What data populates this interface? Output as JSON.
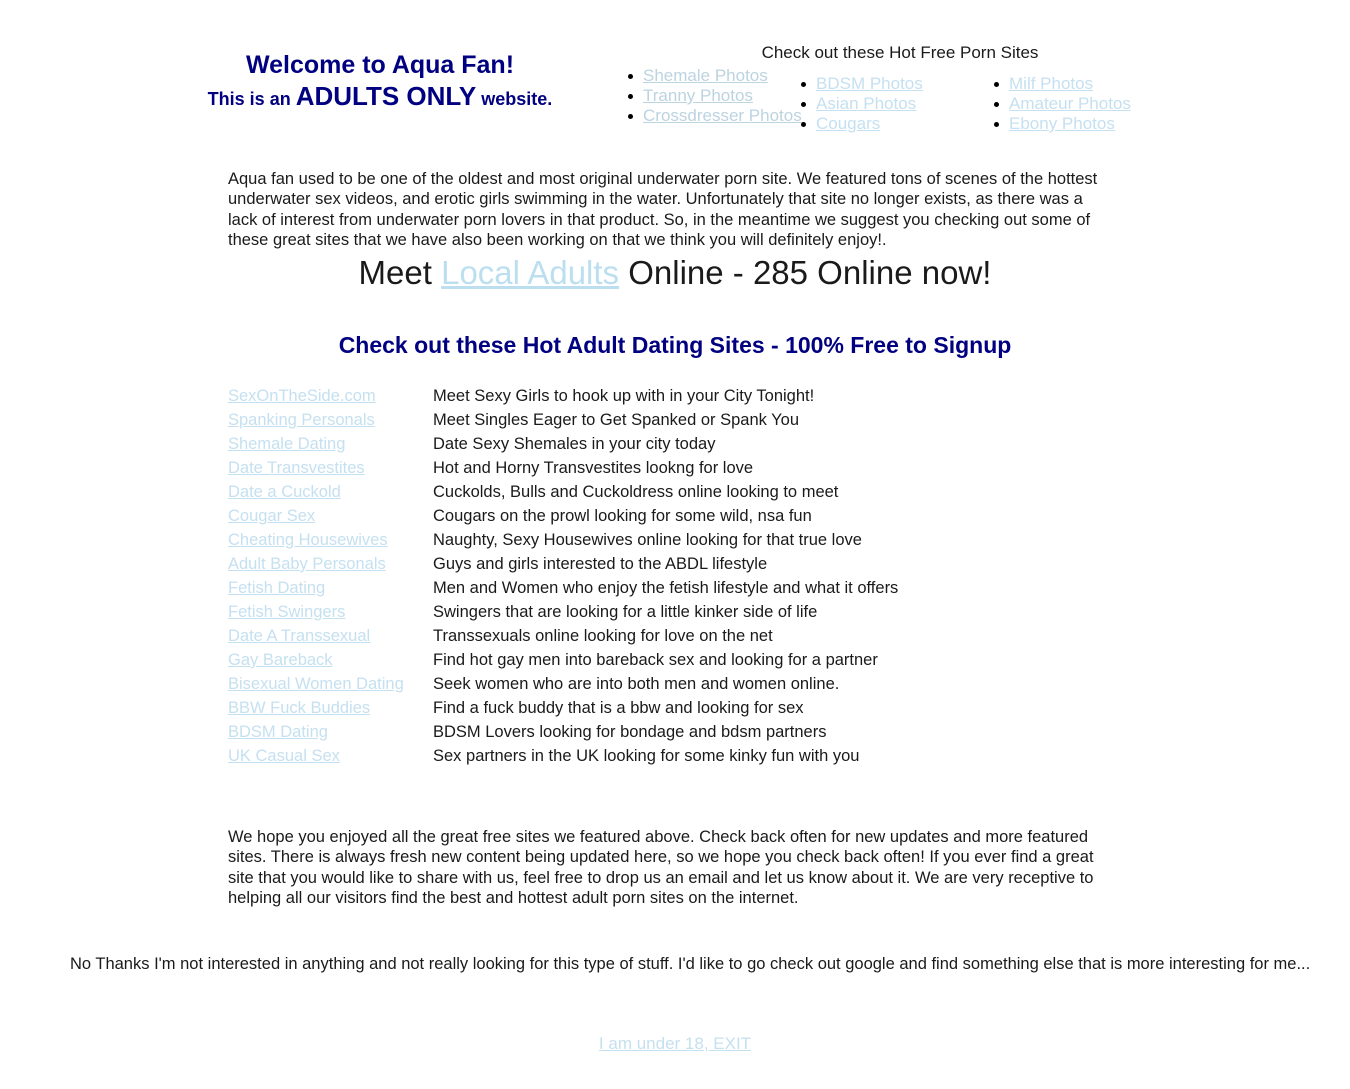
{
  "page": {
    "background_color": "#ffffff",
    "heading_color": "#000080",
    "link_color": "#c5e0f0",
    "text_color": "#1a1a1a"
  },
  "header": {
    "welcome_line1": "Welcome to Aqua Fan!",
    "welcome_prefix": "This is an ",
    "welcome_emphasis": "ADULTS ONLY",
    "welcome_suffix": " website.",
    "porn_sites_heading": "Check out these Hot Free Porn Sites",
    "bullet_columns": [
      {
        "items": [
          {
            "label": "Shemale Photos"
          },
          {
            "label": "Tranny Photos"
          },
          {
            "label": "Crossdresser Photos"
          }
        ]
      },
      {
        "items": [
          {
            "label": "BDSM Photos"
          },
          {
            "label": "Asian Photos"
          },
          {
            "label": "Cougars"
          }
        ]
      },
      {
        "items": [
          {
            "label": "Milf Photos"
          },
          {
            "label": "Amateur Photos"
          },
          {
            "label": "Ebony Photos"
          }
        ]
      }
    ]
  },
  "intro": {
    "paragraph": "Aqua fan used to be one of the oldest and most original underwater porn site. We featured tons of scenes of the hottest underwater sex videos, and erotic girls swimming in the water. Unfortunately that site no longer exists, as there was a lack of interest from underwater porn lovers in that product. So, in the meantime we suggest you checking out some of these great sites that we have also been working on that we think you will definitely enjoy!."
  },
  "meet": {
    "prefix": "Meet ",
    "link_label": "Local Adults",
    "suffix": " Online - 285 Online now!",
    "online_count": "285"
  },
  "dating": {
    "heading": "Check out these Hot Adult Dating Sites - 100% Free to Signup",
    "rows": [
      {
        "site": "SexOnTheSide.com",
        "desc": "Meet Sexy Girls to hook up with in your City Tonight!"
      },
      {
        "site": "Spanking Personals",
        "desc": "Meet Singles Eager to Get Spanked or Spank You"
      },
      {
        "site": "Shemale Dating",
        "desc": "Date Sexy Shemales in your city today"
      },
      {
        "site": "Date Transvestites",
        "desc": "Hot and Horny Transvestites lookng for love"
      },
      {
        "site": "Date a Cuckold",
        "desc": "Cuckolds, Bulls and Cuckoldress online looking to meet"
      },
      {
        "site": "Cougar Sex",
        "desc": "Cougars on the prowl looking for some wild, nsa fun"
      },
      {
        "site": "Cheating Housewives",
        "desc": "Naughty, Sexy Housewives online looking for that true love"
      },
      {
        "site": "Adult Baby Personals",
        "desc": "Guys and girls interested to the ABDL lifestyle"
      },
      {
        "site": "Fetish Dating",
        "desc": "Men and Women who enjoy the fetish lifestyle and what it offers"
      },
      {
        "site": "Fetish Swingers",
        "desc": "Swingers that are looking for a little kinker side of life"
      },
      {
        "site": "Date A Transsexual",
        "desc": "Transsexuals online looking for love on the net"
      },
      {
        "site": "Gay Bareback",
        "desc": "Find hot gay men into bareback sex and looking for a partner"
      },
      {
        "site": "Bisexual Women Dating",
        "desc": "Seek women who are into both men and women online."
      },
      {
        "site": "BBW Fuck Buddies",
        "desc": "Find a fuck buddy that is a bbw and looking for sex"
      },
      {
        "site": "BDSM Dating",
        "desc": "BDSM Lovers looking for bondage and bdsm partners"
      },
      {
        "site": "UK Casual Sex",
        "desc": "Sex partners in the UK looking for some kinky fun with you"
      }
    ]
  },
  "outro": {
    "paragraph": "We hope you enjoyed all the great free sites we featured above. Check back often for new updates and more featured sites. There is always fresh new content being updated here, so we hope you check back often! If you ever find a great site that you would like to share with us, feel free to drop us an email and let us know about it. We are very receptive to helping all our visitors find the best and hottest adult porn sites on the internet."
  },
  "footer": {
    "no_thanks": "No Thanks I'm not interested in anything and not really looking for this type of stuff.  I'd like to go check out google and find something else that is more interesting for me...",
    "exit_link": "I am under 18, EXIT"
  }
}
